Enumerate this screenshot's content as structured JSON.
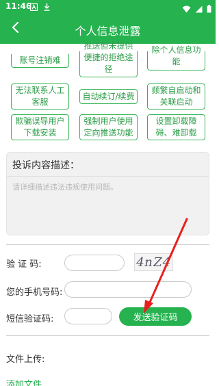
{
  "status_bar": {
    "time": "11:46",
    "icons": [
      "notification-a-icon",
      "download-icon",
      "wifi-icon",
      "signal-icon",
      "battery-icon"
    ]
  },
  "header": {
    "title": "个人信息泄露",
    "back_icon": "back-arrow-icon"
  },
  "tags": [
    {
      "label": "账号注销难"
    },
    {
      "label": "推送但未提供便捷的拒绝途径"
    },
    {
      "label": "除个人信息功能"
    },
    {
      "label": "无法联系人工客服"
    },
    {
      "label": "自动续订/续费"
    },
    {
      "label": "频繁自启动和关联启动"
    },
    {
      "label": "欺骗误导用户下载安装"
    },
    {
      "label": "强制用户使用定向推送功能"
    },
    {
      "label": "设置卸载障碍、难卸载"
    }
  ],
  "complaint": {
    "title": "投诉内容描述：",
    "placeholder": "请详细描述违法违规使用问题。"
  },
  "form": {
    "captcha_label": "验 证 码:",
    "captcha_text": "4nZ4",
    "phone_label": "您的手机号码:",
    "sms_label": "短信验证码:",
    "send_button": "发送验证码"
  },
  "upload": {
    "label": "文件上传:",
    "add_file": "添加文件"
  },
  "colors": {
    "brand_green": "#25b24f",
    "annotation_red": "#e8201e"
  }
}
